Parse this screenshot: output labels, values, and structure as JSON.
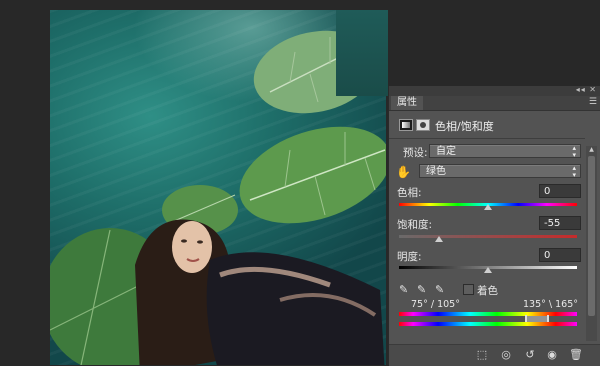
{
  "panel": {
    "tab_label": "属性",
    "collapse_controls": "◂◂ ✕",
    "menu_icon": "menu-icon",
    "title": "色相/饱和度",
    "preset_label": "预设:",
    "preset_value": "自定",
    "channel_value": "绿色",
    "hue_label": "色相:",
    "hue_value": "0",
    "hue_level": 0,
    "saturation_label": "饱和度:",
    "saturation_value": "-55",
    "saturation_level": -55,
    "lightness_label": "明度:",
    "lightness_value": "0",
    "lightness_level": 0,
    "colorize_label": "着色",
    "colorize_checked": false,
    "range_left": "75° / 105°",
    "range_right": "135° \\ 165°"
  },
  "icons": {
    "adjustment": "hue-saturation-adjustment-icon",
    "mask": "layer-mask-icon",
    "hand": "targeted-adjustment-hand-icon",
    "eyedropper": "eyedropper-icon",
    "eyedropper_add": "eyedropper-plus-icon",
    "eyedropper_sub": "eyedropper-minus-icon",
    "bottom": [
      "clip-to-layer-icon",
      "view-previous-icon",
      "reset-icon",
      "visibility-eye-icon",
      "trash-icon"
    ]
  },
  "colors": {
    "panel_bg": "#535353",
    "water": "#1e6e69",
    "leaf": "#4f8a44"
  }
}
